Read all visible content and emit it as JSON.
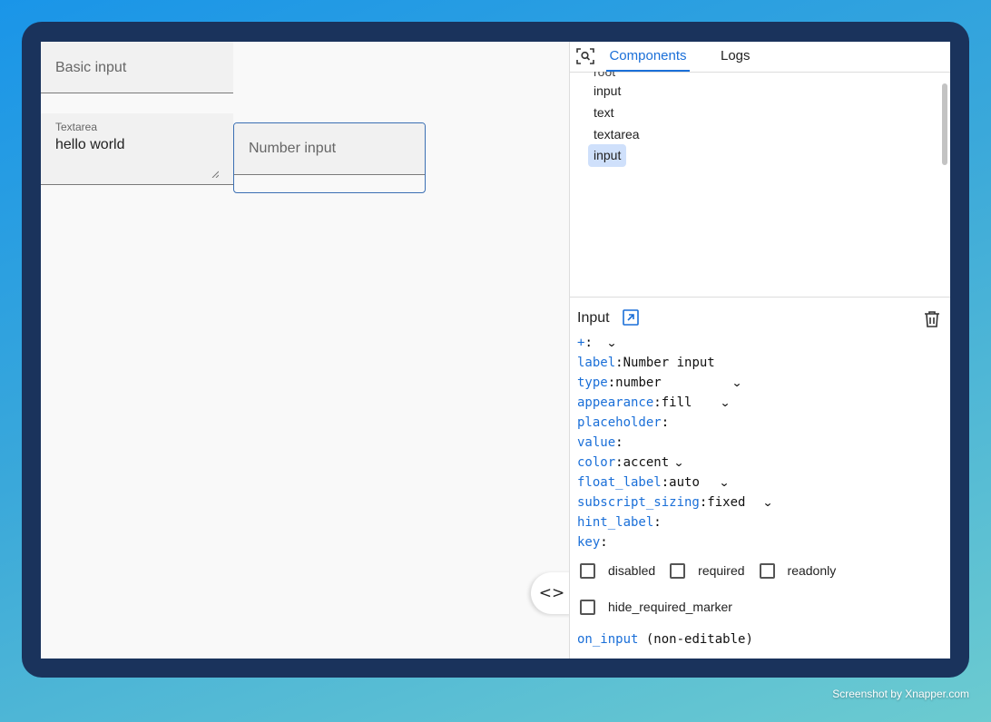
{
  "canvas": {
    "basic_input": {
      "label": "Basic input"
    },
    "textarea": {
      "label": "Textarea",
      "value": "hello world"
    },
    "number_input": {
      "label": "Number input"
    }
  },
  "toggle_button": {
    "label": "<>"
  },
  "panel": {
    "tabs": [
      {
        "label": "Components",
        "active": true
      },
      {
        "label": "Logs",
        "active": false
      }
    ],
    "tree": {
      "clipped_item": "root",
      "items": [
        {
          "label": "input",
          "selected": false
        },
        {
          "label": "text",
          "selected": false
        },
        {
          "label": "textarea",
          "selected": false
        },
        {
          "label": "input",
          "selected": true
        }
      ]
    },
    "properties": {
      "title": "Input",
      "rows": [
        {
          "key": "+",
          "value": "",
          "dropdown": true
        },
        {
          "key": "label",
          "value": "Number input",
          "dropdown": false
        },
        {
          "key": "type",
          "value": "number",
          "dropdown": true
        },
        {
          "key": "appearance",
          "value": "fill",
          "dropdown": true
        },
        {
          "key": "placeholder",
          "value": "",
          "dropdown": false
        },
        {
          "key": "value",
          "value": "",
          "dropdown": false
        },
        {
          "key": "color",
          "value": "accent",
          "dropdown": true
        },
        {
          "key": "float_label",
          "value": "auto",
          "dropdown": true
        },
        {
          "key": "subscript_sizing",
          "value": "fixed",
          "dropdown": true
        },
        {
          "key": "hint_label",
          "value": "",
          "dropdown": false
        },
        {
          "key": "key",
          "value": "",
          "dropdown": false
        }
      ],
      "checkboxes": [
        {
          "label": "disabled",
          "checked": false
        },
        {
          "label": "required",
          "checked": false
        },
        {
          "label": "readonly",
          "checked": false
        },
        {
          "label": "hide_required_marker",
          "checked": false
        }
      ],
      "event": {
        "key": "on_input",
        "note": "(non-editable)"
      }
    }
  },
  "credit": "Screenshot by Xnapper.com",
  "colors": {
    "accent": "#1a6fd8",
    "selection": "#cfe0fb",
    "frame": "#1a335c"
  }
}
